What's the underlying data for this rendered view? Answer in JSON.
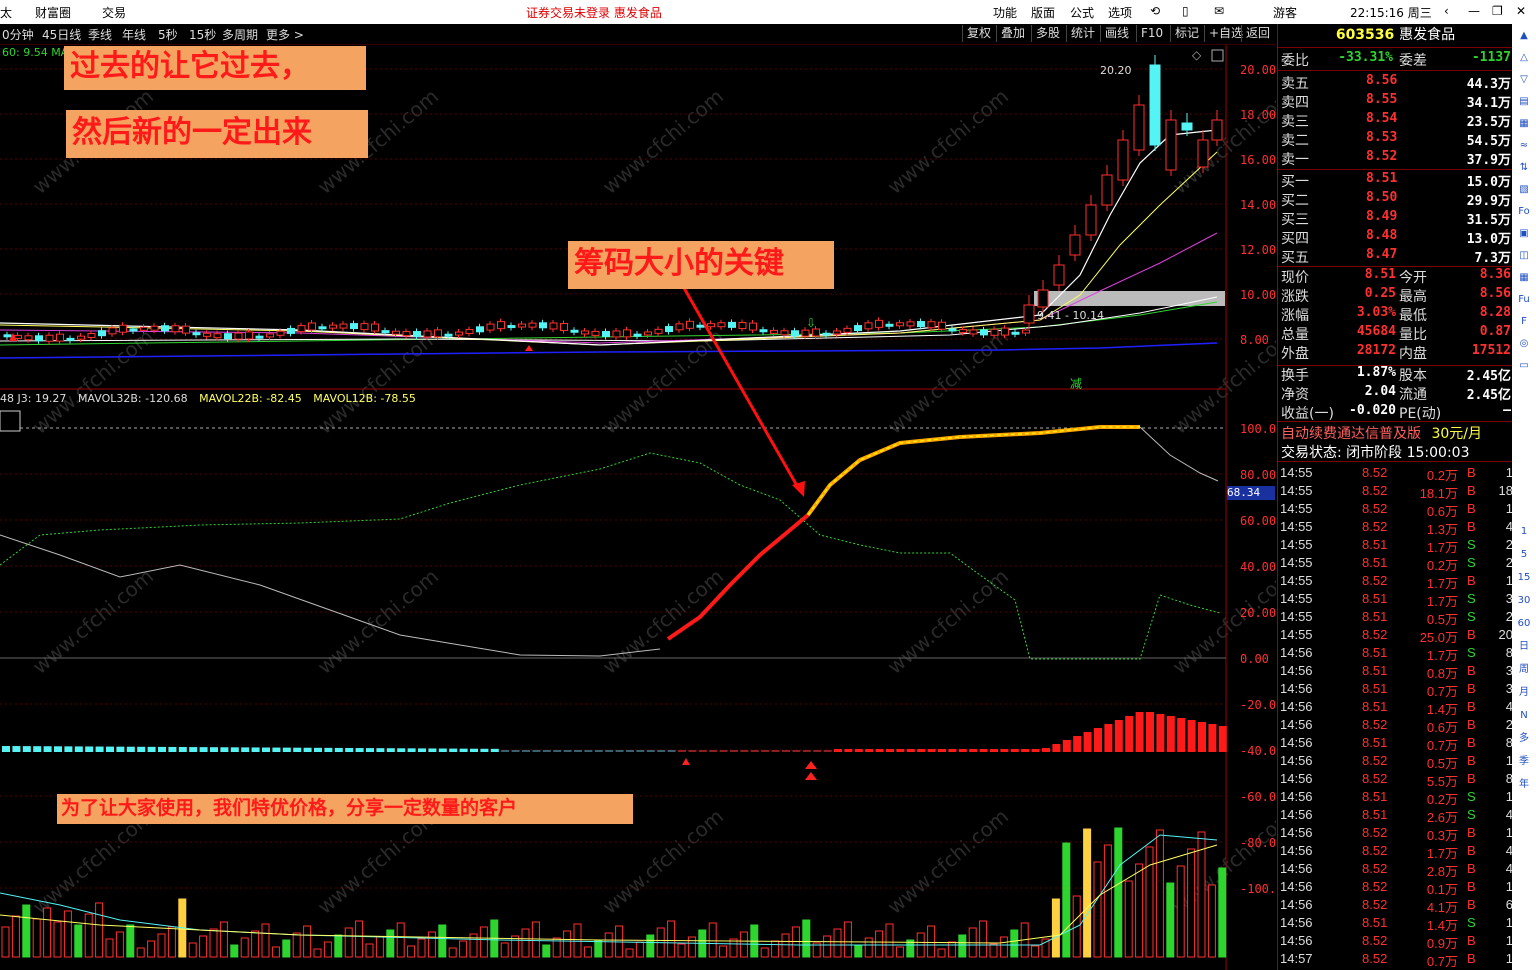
{
  "topbar": {
    "left_items": [
      "太",
      "财富圈",
      "交易"
    ],
    "status": "证券交易未登录  惠发食品",
    "menus": [
      "功能",
      "版面",
      "公式",
      "选项"
    ],
    "user": "游客",
    "clock": "22:15:16 周三"
  },
  "toolbar": {
    "periods": [
      "0分钟",
      "45日线",
      "季线",
      "年线",
      "5秒",
      "15秒",
      "多周期",
      "更多 >"
    ],
    "buttons": [
      "复权",
      "叠加",
      "多股",
      "统计",
      "画线",
      "F10",
      "标记",
      "+自选",
      "返回"
    ]
  },
  "chart": {
    "ma_label": "60: 9.54  MA",
    "high_label": "20.20",
    "range_label": "9.41 - 10.14",
    "price_axis": [
      "20.00",
      "18.00",
      "16.00",
      "14.00",
      "12.00",
      "10.00",
      "8.00"
    ],
    "jian_label": "减",
    "indicator_header": {
      "j3": "48  J3: 19.27",
      "mavol32": "MAVOL32B: -120.68",
      "mavol22": "MAVOL22B: -82.45",
      "mavol12": "MAVOL12B: -78.55"
    },
    "indicator_axis": [
      "100.0",
      "80.00",
      "60.00",
      "40.00",
      "20.00",
      "0.00",
      "-20.00",
      "-40.00",
      "-60.00",
      "-80.00",
      "-100.0"
    ],
    "current_value": "68.34",
    "watermark": "www.cfchi.com"
  },
  "annotations": {
    "line1": "过去的让它过去，",
    "line2": "然后新的一定出来",
    "key": "筹码大小的关键",
    "promo": "为了让大家使用，我们特优价格，分享一定数量的客户"
  },
  "quote": {
    "code": "603536",
    "name": "惠发食品",
    "weibi_label": "委比",
    "weibi": "-33.31%",
    "weicha_label": "委差",
    "weicha": "-1137",
    "asks": [
      {
        "label": "卖五",
        "price": "8.56",
        "vol": "44.3万"
      },
      {
        "label": "卖四",
        "price": "8.55",
        "vol": "34.1万"
      },
      {
        "label": "卖三",
        "price": "8.54",
        "vol": "23.5万"
      },
      {
        "label": "卖二",
        "price": "8.53",
        "vol": "54.5万"
      },
      {
        "label": "卖一",
        "price": "8.52",
        "vol": "37.9万"
      }
    ],
    "bids": [
      {
        "label": "买一",
        "price": "8.51",
        "vol": "15.0万"
      },
      {
        "label": "买二",
        "price": "8.50",
        "vol": "29.9万"
      },
      {
        "label": "买三",
        "price": "8.49",
        "vol": "31.5万"
      },
      {
        "label": "买四",
        "price": "8.48",
        "vol": "13.0万"
      },
      {
        "label": "买五",
        "price": "8.47",
        "vol": "7.3万"
      }
    ],
    "stats": [
      {
        "l1": "现价",
        "v1": "8.51",
        "l2": "今开",
        "v2": "8.36"
      },
      {
        "l1": "涨跌",
        "v1": "0.25",
        "l2": "最高",
        "v2": "8.56"
      },
      {
        "l1": "涨幅",
        "v1": "3.03%",
        "l2": "最低",
        "v2": "8.28"
      },
      {
        "l1": "总量",
        "v1": "45684",
        "l2": "量比",
        "v2": "0.87"
      },
      {
        "l1": "外盘",
        "v1": "28172",
        "l2": "内盘",
        "v2": "17512"
      }
    ],
    "stats2": [
      {
        "l1": "换手",
        "v1": "1.87%",
        "l2": "股本",
        "v2": "2.45亿"
      },
      {
        "l1": "净资",
        "v1": "2.04",
        "l2": "流通",
        "v2": "2.45亿"
      },
      {
        "l1": "收益(一)",
        "v1": "-0.020",
        "l2": "PE(动)",
        "v2": "—"
      }
    ],
    "ad": "自动续费通达信普及版",
    "ad_price": "30元/月",
    "trade_state": "交易状态: 闭市阶段 15:00:03"
  },
  "ticks": [
    [
      "14:55",
      "8.52",
      "0.2万",
      "B",
      "1"
    ],
    [
      "14:55",
      "8.52",
      "18.1万",
      "B",
      "18"
    ],
    [
      "14:55",
      "8.52",
      "0.6万",
      "B",
      "1"
    ],
    [
      "14:55",
      "8.52",
      "1.3万",
      "B",
      "4"
    ],
    [
      "14:55",
      "8.51",
      "1.7万",
      "S",
      "2"
    ],
    [
      "14:55",
      "8.51",
      "0.2万",
      "S",
      "2"
    ],
    [
      "14:55",
      "8.52",
      "1.7万",
      "B",
      "1"
    ],
    [
      "14:55",
      "8.51",
      "1.7万",
      "S",
      "3"
    ],
    [
      "14:55",
      "8.51",
      "0.5万",
      "S",
      "2"
    ],
    [
      "14:55",
      "8.52",
      "25.0万",
      "B",
      "20"
    ],
    [
      "14:56",
      "8.51",
      "1.7万",
      "S",
      "8"
    ],
    [
      "14:56",
      "8.51",
      "0.8万",
      "B",
      "3"
    ],
    [
      "14:56",
      "8.51",
      "0.7万",
      "B",
      "3"
    ],
    [
      "14:56",
      "8.51",
      "1.4万",
      "B",
      "4"
    ],
    [
      "14:56",
      "8.52",
      "0.6万",
      "B",
      "2"
    ],
    [
      "14:56",
      "8.51",
      "0.7万",
      "B",
      "8"
    ],
    [
      "14:56",
      "8.52",
      "0.5万",
      "B",
      "1"
    ],
    [
      "14:56",
      "8.52",
      "5.5万",
      "B",
      "8"
    ],
    [
      "14:56",
      "8.51",
      "0.2万",
      "S",
      "1"
    ],
    [
      "14:56",
      "8.51",
      "2.6万",
      "S",
      "4"
    ],
    [
      "14:56",
      "8.52",
      "0.3万",
      "B",
      "1"
    ],
    [
      "14:56",
      "8.52",
      "1.7万",
      "B",
      "4"
    ],
    [
      "14:56",
      "8.52",
      "2.8万",
      "B",
      "4"
    ],
    [
      "14:56",
      "8.52",
      "0.1万",
      "B",
      "1"
    ],
    [
      "14:56",
      "8.52",
      "4.1万",
      "B",
      "6"
    ],
    [
      "14:56",
      "8.51",
      "1.4万",
      "S",
      "1"
    ],
    [
      "14:56",
      "8.52",
      "0.9万",
      "B",
      "1"
    ],
    [
      "14:57",
      "8.52",
      "0.7万",
      "B",
      "1"
    ]
  ],
  "sidebar_items": [
    "1",
    "5",
    "15",
    "30",
    "60",
    "日",
    "周",
    "月",
    "N",
    "多",
    "季",
    "年"
  ],
  "colors": {
    "up": "#ff3030",
    "down": "#2fd52f",
    "cyan": "#54f4f4",
    "annotation_bg": "#f4a460",
    "panel_border": "#a00000"
  }
}
